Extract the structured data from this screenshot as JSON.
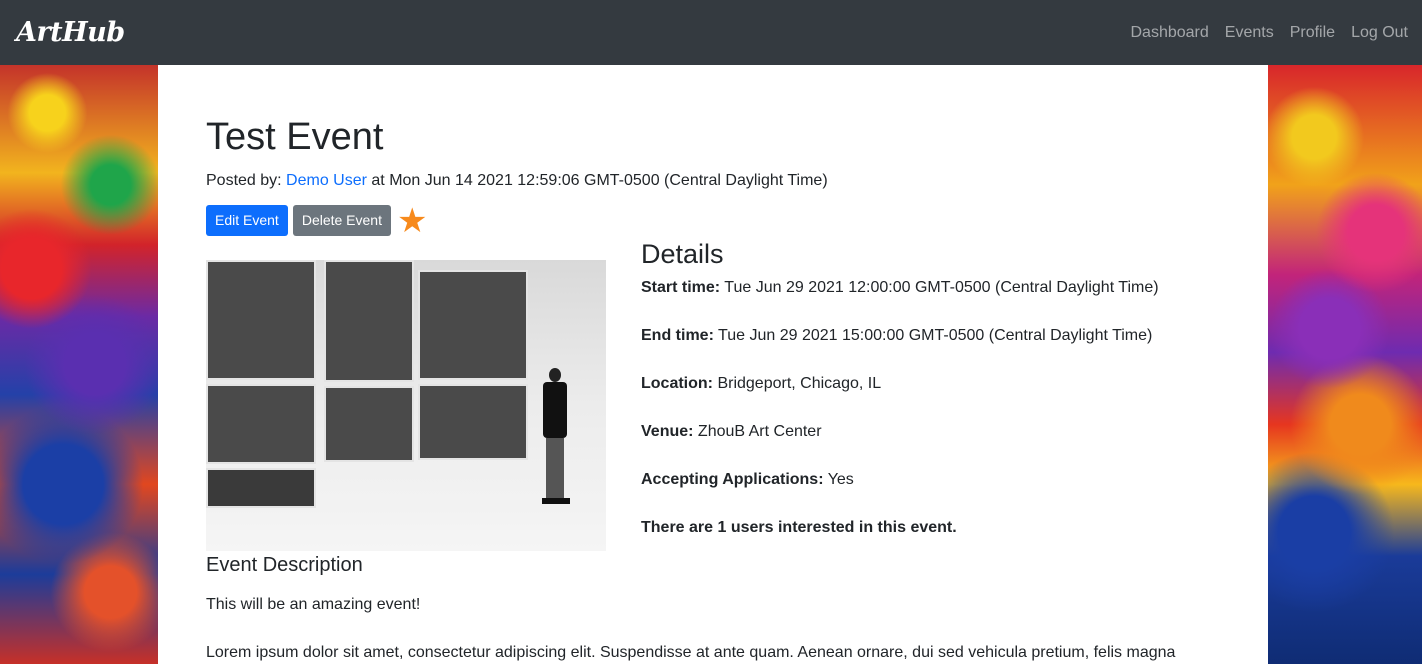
{
  "navbar": {
    "brand": "ArtHub",
    "links": [
      "Dashboard",
      "Events",
      "Profile",
      "Log Out"
    ]
  },
  "event": {
    "title": "Test Event",
    "posted_prefix": "Posted by: ",
    "author": "Demo User",
    "posted_suffix": " at Mon Jun 14 2021 12:59:06 GMT-0500 (Central Daylight Time)",
    "edit_label": "Edit Event",
    "delete_label": "Delete Event",
    "star_icon": "star-icon",
    "star_color": "#f78a1c"
  },
  "details": {
    "heading": "Details",
    "start_label": "Start time:",
    "start_value": " Tue Jun 29 2021 12:00:00 GMT-0500 (Central Daylight Time)",
    "end_label": "End time:",
    "end_value": " Tue Jun 29 2021 15:00:00 GMT-0500 (Central Daylight Time)",
    "location_label": "Location:",
    "location_value": " Bridgeport, Chicago, IL",
    "venue_label": "Venue:",
    "venue_value": " ZhouB Art Center",
    "accepting_label": "Accepting Applications:",
    "accepting_value": " Yes",
    "interest_text": "There are 1 users interested in this event."
  },
  "description": {
    "heading": "Event Description",
    "text": "This will be an amazing event!",
    "lorem": "Lorem ipsum dolor sit amet, consectetur adipiscing elit. Suspendisse at ante quam. Aenean ornare, dui sed vehicula pretium, felis magna"
  },
  "colors": {
    "navbar_bg": "#343a40",
    "primary": "#0d6efd",
    "secondary": "#6c757d"
  }
}
